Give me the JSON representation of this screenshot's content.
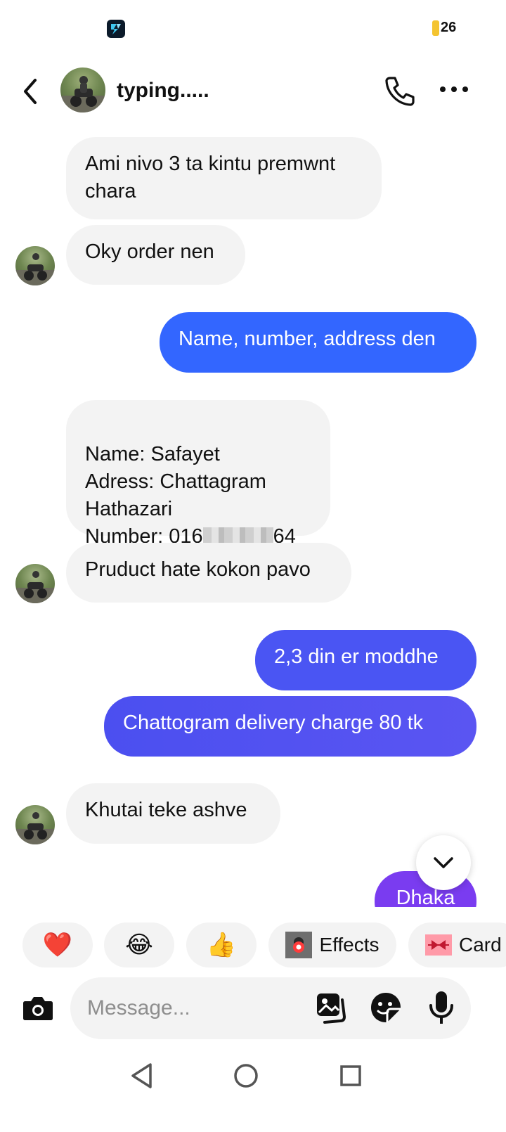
{
  "status_bar": {
    "battery_label": "26",
    "app_icon": "app-logo-icon"
  },
  "header": {
    "title": "typing.....",
    "back_icon": "chevron-left-icon",
    "call_icon": "phone-icon",
    "more_icon": "more-horizontal-icon"
  },
  "messages": [
    {
      "side": "in",
      "text": "Ami nivo 3 ta kintu premwnt\nchara",
      "avatar": false
    },
    {
      "side": "in",
      "text": "Oky order nen",
      "avatar": true
    },
    {
      "side": "out",
      "text": "Name, number, address den"
    },
    {
      "side": "in",
      "text": "Name: Safayet\nAdress: Chattagram\nHathazari\nNumber: 016",
      "redacted_suffix": "64",
      "avatar": false
    },
    {
      "side": "in",
      "text": "Pruduct hate kokon pavo",
      "avatar": true
    },
    {
      "side": "out",
      "text": "2,3 din er moddhe"
    },
    {
      "side": "out",
      "text": "Chattogram delivery charge 80 tk"
    },
    {
      "side": "in",
      "text": "Khutai teke ashve",
      "avatar": true
    },
    {
      "side": "out",
      "text": "Dhaka",
      "partial": true
    }
  ],
  "scroll_down_icon": "chevron-down-icon",
  "quick_reactions": [
    {
      "emoji": "❤️",
      "name": "heart"
    },
    {
      "emoji": "😂",
      "name": "laugh"
    },
    {
      "emoji": "👍",
      "name": "thumbs-up"
    },
    {
      "label": "Effects",
      "icon": "effects-icon"
    },
    {
      "label": "Card",
      "icon": "card-icon"
    }
  ],
  "composer": {
    "placeholder": "Message...",
    "camera_icon": "camera-icon",
    "gallery_icon": "gallery-icon",
    "sticker_icon": "sticker-icon",
    "mic_icon": "microphone-icon"
  },
  "nav": {
    "back_icon": "nav-back-icon",
    "home_icon": "nav-home-icon",
    "recents_icon": "nav-recents-icon"
  },
  "colors": {
    "incoming_bubble": "#f3f3f3",
    "outgoing_blue": "#3366ff",
    "outgoing_indigo": "#4f4ef2",
    "outgoing_purple": "#7a3cf0"
  }
}
